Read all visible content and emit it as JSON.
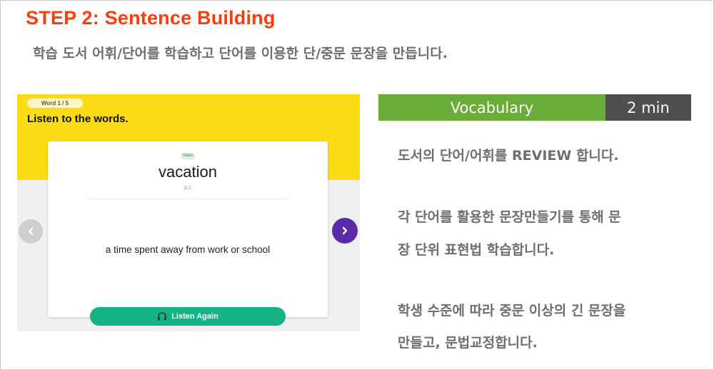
{
  "header": {
    "step_title": "STEP 2: Sentence Building",
    "subtitle": "학습 도서 어휘/단어를 학습하고 단어를 이용한 단/중문 문장을 만듭니다."
  },
  "flashcard": {
    "counter": "Word 1 / 5",
    "instruction": "Listen to the words.",
    "part_of_speech": "noun",
    "word": "vacation",
    "page_ref": "p.2",
    "definition": "a time spent away from work or school",
    "listen_button_label": "Listen Again",
    "prev_icon": "chevron-left-icon",
    "next_icon": "chevron-right-icon",
    "listen_icon": "headphones-icon",
    "colors": {
      "banner": "#fcdc14",
      "listen_button": "#14b385",
      "next_button": "#5a2aa8",
      "prev_button": "#cfcfcf"
    }
  },
  "info": {
    "section_label": "Vocabulary",
    "duration": "2 min",
    "colors": {
      "section": "#6aab3a",
      "duration": "#4f4f4f",
      "title": "#ff3b0a"
    },
    "lines": [
      "도서의 단어/어휘를 REVIEW 합니다.",
      "각 단어를 활용한 문장만들기를 통해  문",
      "장 단위 표현법 학습합니다.",
      "학생 수준에 따라 중문 이상의 긴 문장을",
      "만들고, 문법교정합니다."
    ]
  }
}
